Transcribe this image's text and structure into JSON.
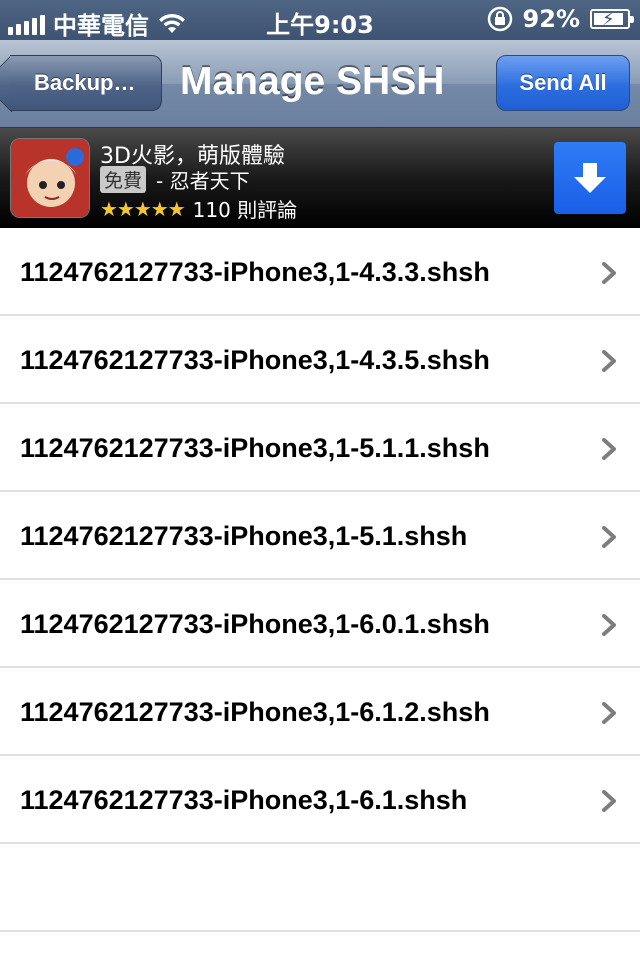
{
  "status_bar": {
    "carrier": "中華電信",
    "time": "上午9:03",
    "battery_percent": "92%",
    "battery_level": 0.92,
    "icons": [
      "signal-bars-icon",
      "wifi-icon",
      "rotation-lock-icon",
      "battery-charging-icon"
    ]
  },
  "nav": {
    "back_label": "Backup…",
    "title": "Manage SHSH",
    "action_label": "Send All"
  },
  "ad": {
    "title": "3D火影，萌版體驗",
    "price_badge": "免費",
    "developer": "- 忍者天下",
    "stars": "★★★★★",
    "rating_count": "110 則評論",
    "download_icon": "download-arrow-icon"
  },
  "files": [
    {
      "label": "1124762127733-iPhone3,1-4.3.3.shsh"
    },
    {
      "label": "1124762127733-iPhone3,1-4.3.5.shsh"
    },
    {
      "label": "1124762127733-iPhone3,1-5.1.1.shsh"
    },
    {
      "label": "1124762127733-iPhone3,1-5.1.shsh"
    },
    {
      "label": "1124762127733-iPhone3,1-6.0.1.shsh"
    },
    {
      "label": "1124762127733-iPhone3,1-6.1.2.shsh"
    },
    {
      "label": "1124762127733-iPhone3,1-6.1.shsh"
    }
  ],
  "colors": {
    "nav_gradient_top": "#b8c4d4",
    "nav_gradient_bottom": "#6b80a0",
    "accent_blue": "#1f5fd4",
    "star_yellow": "#f7c62f"
  }
}
